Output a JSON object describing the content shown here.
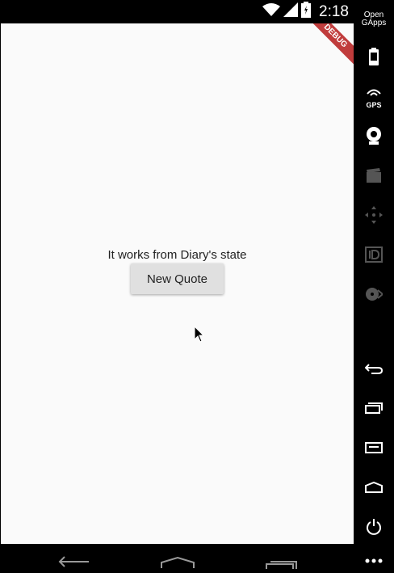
{
  "status_bar": {
    "time": "2:18",
    "icons": [
      "wifi-icon",
      "signal-icon",
      "battery-icon"
    ]
  },
  "app": {
    "banner": "DEBUG",
    "message": "It works from Diary's state",
    "button_label": "New Quote"
  },
  "side_panel": {
    "logo_label": "Open GApps",
    "gps_label": "GPS",
    "buttons": [
      "battery-icon",
      "gps-icon",
      "webcam-icon",
      "media-icon",
      "move-icon",
      "id-icon",
      "disk-icon",
      "back-icon",
      "recent-apps-icon",
      "menu-icon",
      "home-icon",
      "power-icon"
    ]
  },
  "nav_bar": {
    "buttons": [
      "back-icon",
      "home-icon",
      "recent-apps-icon",
      "overflow-icon"
    ]
  }
}
